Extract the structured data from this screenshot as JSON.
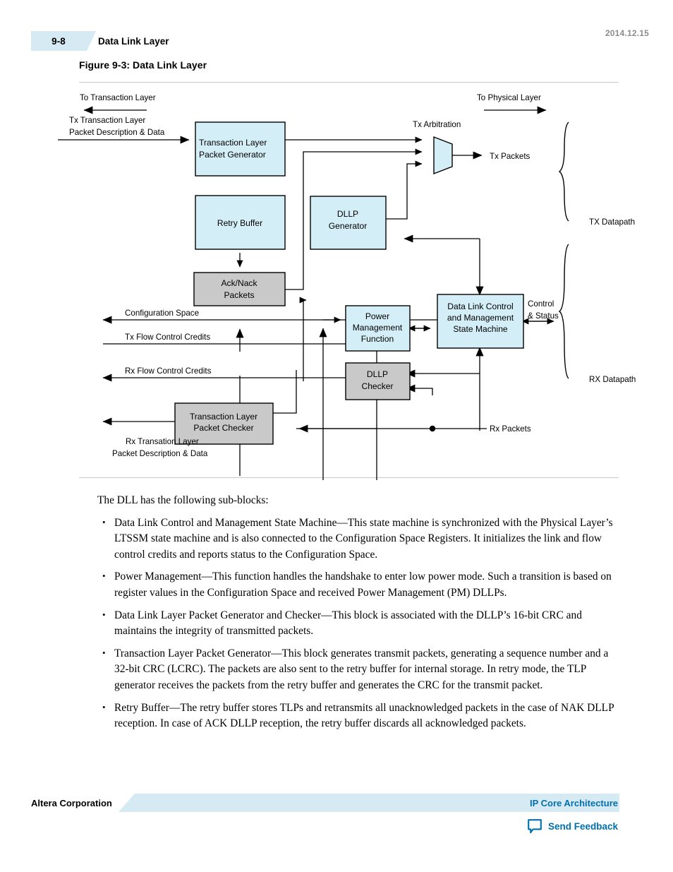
{
  "header": {
    "page_number": "9-8",
    "chapter_title": "Data Link Layer",
    "date": "2014.12.15"
  },
  "figure": {
    "title": "Figure 9-3: Data Link Layer",
    "boxes": {
      "tlp_generator_line1": "Transaction Layer",
      "tlp_generator_line2": "Packet Generator",
      "retry_buffer": "Retry Buffer",
      "dllp_generator_line1": "DLLP",
      "dllp_generator_line2": "Generator",
      "ack_nack_line1": "Ack/Nack",
      "ack_nack_line2": "Packets",
      "power_mgmt_line1": "Power",
      "power_mgmt_line2": "Management",
      "power_mgmt_line3": "Function",
      "dlcmsm_line1": "Data Link Control",
      "dlcmsm_line2": "and  Management",
      "dlcmsm_line3": "State Machine",
      "dllp_checker_line1": "DLLP",
      "dllp_checker_line2": "Checker",
      "tlp_checker_line1": "Transaction Layer",
      "tlp_checker_line2": "Packet Checker"
    },
    "labels": {
      "to_transaction_layer": "To Transaction Layer",
      "to_physical_layer": "To Physical Layer",
      "tx_tl_desc_line1": "Tx Transaction Layer",
      "tx_tl_desc_line2": "Packet Description & Data",
      "tx_arbitration": "Tx Arbitration",
      "tx_packets": "Tx Packets",
      "tx_datapath": "TX Datapath",
      "rx_datapath": "RX Datapath",
      "control_status_line1": "Control",
      "control_status_line2": "& Status",
      "configuration_space": "Configuration Space",
      "tx_flow_control_credits": "Tx Flow Control Credits",
      "rx_flow_control_credits": "Rx Flow Control Credits",
      "rx_packets": "Rx Packets",
      "rx_tl_desc_line1": "Rx Transation Layer",
      "rx_tl_desc_line2": "Packet Description & Data"
    },
    "colors": {
      "box_blue": "#d4eef7",
      "box_gray": "#c9c9c9",
      "stroke": "#000000"
    }
  },
  "body": {
    "intro": "The DLL has the following sub-blocks:",
    "bullets": [
      "Data Link Control and Management State Machine—This state machine is synchronized with the Physical Layer’s LTSSM state machine and is also connected to the Configuration Space Registers. It initializes the link and flow control credits and reports status to the Configuration Space.",
      "Power Management—This function handles the handshake to enter low power mode. Such a transition is based on register values in the Configuration Space and received Power Management (PM) DLLPs.",
      "Data Link Layer Packet Generator and Checker—This block is associated with the DLLP’s 16-bit CRC and maintains the integrity of transmitted packets.",
      "Transaction Layer Packet Generator—This block generates transmit packets, generating a sequence number and a 32-bit CRC (LCRC). The packets are also sent to the retry buffer for internal storage. In retry mode, the TLP generator receives the packets from the retry buffer and generates the CRC for the transmit packet.",
      "Retry Buffer—The retry buffer stores TLPs and retransmits all unacknowledged packets in the case of NAK DLLP reception. In case of ACK DLLP reception, the retry buffer discards all acknowledged packets."
    ]
  },
  "footer": {
    "company": "Altera Corporation",
    "doc_link": "IP Core Architecture",
    "send_feedback": "Send Feedback",
    "link_color": "#0070ad"
  }
}
